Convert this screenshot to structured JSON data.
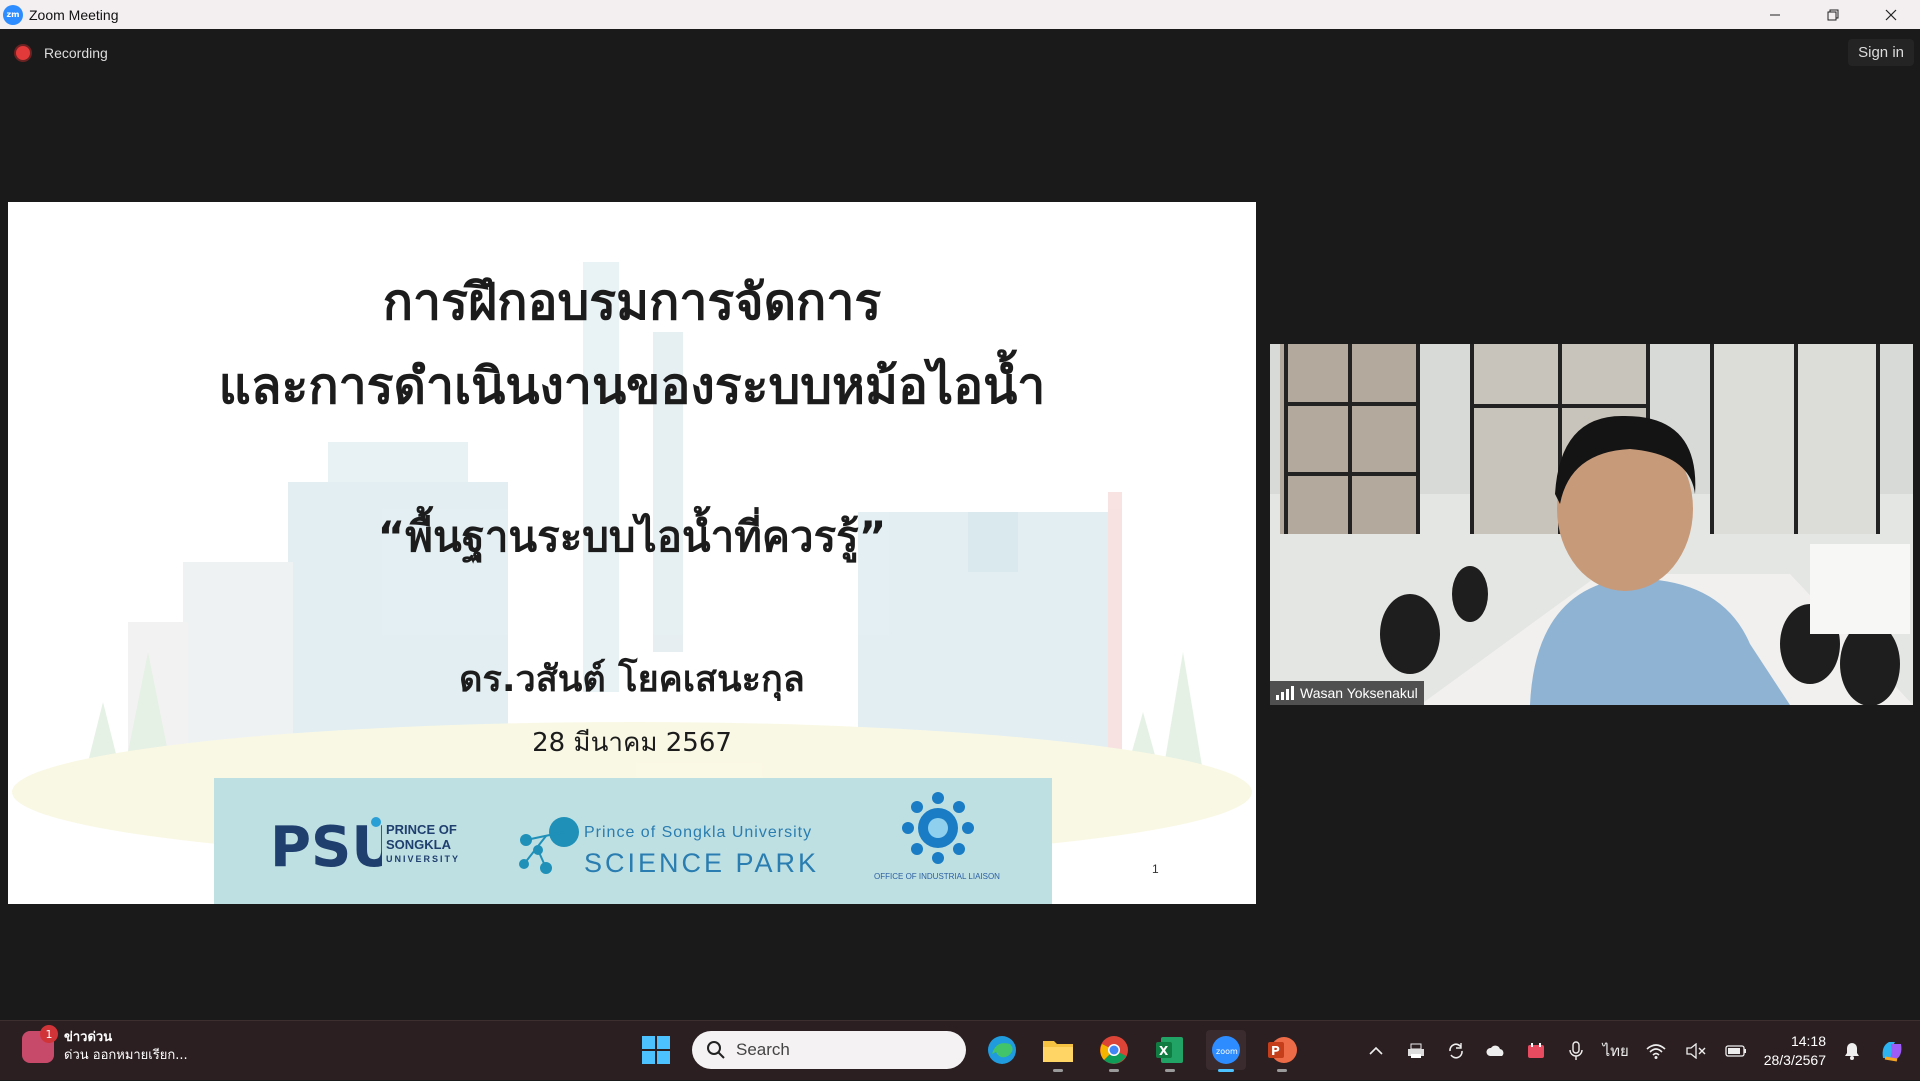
{
  "window": {
    "title": "Zoom Meeting",
    "app_icon_text": "zm",
    "controls": [
      "minimize",
      "restore",
      "close"
    ]
  },
  "meeting": {
    "recording_label": "Recording",
    "signin_label": "Sign in"
  },
  "slide": {
    "title_line1": "การฝึกอบรมการจัดการ",
    "title_line2": "และการดำเนินงานของระบบหม้อไอน้ำ",
    "subtitle": "“พื้นฐานระบบไอน้ำที่ควรรู้”",
    "presenter": "ดร.วสันต์  โยคเสนะกุล",
    "date": "28 มีนาคม 2567",
    "psu_text": [
      "PRINCE OF",
      "SONGKLA",
      "UNIVERSITY"
    ],
    "science_park_line1": "Prince of Songkla University",
    "science_park_line2": "SCIENCE PARK",
    "oil_text": "OFFICE OF INDUSTRIAL LIAISON",
    "page_number": "1"
  },
  "participant": {
    "name": "Wasan Yoksenakul"
  },
  "taskbar": {
    "news_badge": "1",
    "news_title": "ข่าวด่วน",
    "news_subtitle": "ด่วน ออกหมายเรียก...",
    "search_placeholder": "Search",
    "apps": [
      "edge-icon",
      "file-explorer-icon",
      "chrome-icon",
      "excel-icon",
      "zoom-icon",
      "powerpoint-icon"
    ],
    "active_app": "zoom-icon",
    "language": "ไทย",
    "time": "14:18",
    "date": "28/3/2567"
  },
  "colors": {
    "accent": "#2d8cff",
    "recording": "#e23a3a",
    "taskbar_bg": "#2b1f21"
  }
}
